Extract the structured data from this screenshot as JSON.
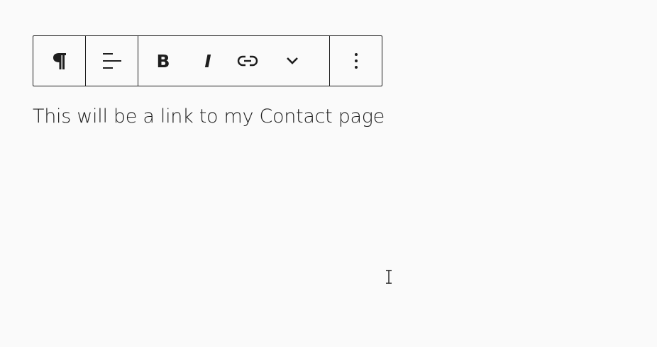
{
  "toolbar": {
    "block_type_icon": "pilcrow-icon",
    "align_icon": "align-left-icon",
    "bold_label": "B",
    "italic_label": "I",
    "link_icon": "link-icon",
    "more_formats_icon": "chevron-down-icon",
    "options_icon": "more-vertical-icon"
  },
  "editor": {
    "paragraph_text": "This will be a link to my Contact page"
  },
  "colors": {
    "text": "#1e1e1e",
    "background": "#fafafa",
    "border": "#1e1e1e"
  }
}
